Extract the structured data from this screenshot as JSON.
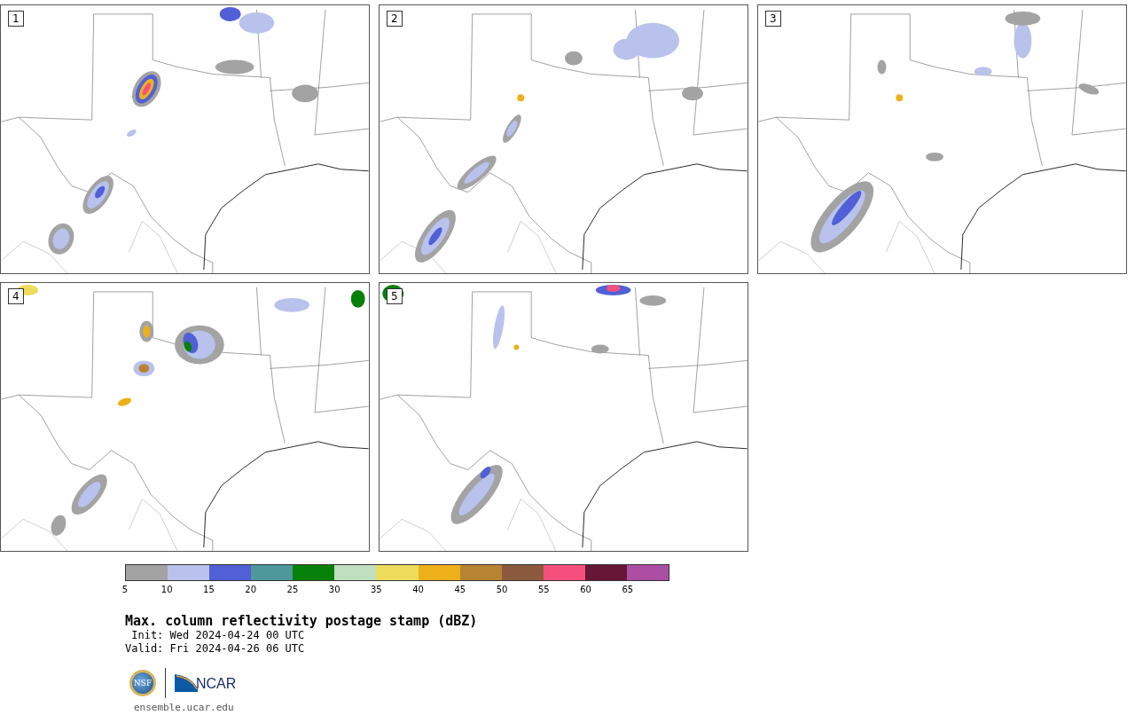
{
  "panels": [
    {
      "label": "1"
    },
    {
      "label": "2"
    },
    {
      "label": "3"
    },
    {
      "label": "4"
    },
    {
      "label": "5"
    }
  ],
  "colorbar": {
    "bins": [
      {
        "color": "#a3a3a3"
      },
      {
        "color": "#b8c2ec"
      },
      {
        "color": "#5160d6"
      },
      {
        "color": "#4e979b"
      },
      {
        "color": "#078009"
      },
      {
        "color": "#c0dfc0"
      },
      {
        "color": "#eedc5b"
      },
      {
        "color": "#eeb01a"
      },
      {
        "color": "#b88431"
      },
      {
        "color": "#8b5a3e"
      },
      {
        "color": "#f5507d"
      },
      {
        "color": "#661636"
      },
      {
        "color": "#ab4ea4"
      }
    ],
    "ticks": [
      "5",
      "10",
      "15",
      "20",
      "25",
      "30",
      "35",
      "40",
      "45",
      "50",
      "55",
      "60",
      "65"
    ]
  },
  "title": "Max. column reflectivity postage stamp (dBZ)",
  "init": " Init: Wed 2024-04-24 00 UTC",
  "valid": "Valid: Fri 2024-04-26 06 UTC",
  "logos": {
    "nsf": "NSF",
    "ncar": "NCAR"
  },
  "url": "ensemble.ucar.edu"
}
